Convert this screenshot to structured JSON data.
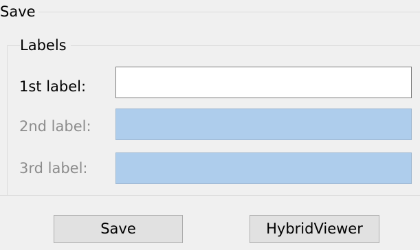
{
  "save_group": {
    "title": "Save"
  },
  "labels_group": {
    "title": "Labels",
    "fields": [
      {
        "label": "1st label:",
        "value": "",
        "enabled": true
      },
      {
        "label": "2nd label:",
        "value": "",
        "enabled": false
      },
      {
        "label": "3rd label:",
        "value": "",
        "enabled": false
      }
    ]
  },
  "buttons": {
    "save_label": "Save",
    "hybrid_viewer_label": "HybridViewer"
  },
  "colors": {
    "background": "#f0f0f0",
    "disabled_field": "#aecdec",
    "disabled_text": "#8c8c8c"
  }
}
